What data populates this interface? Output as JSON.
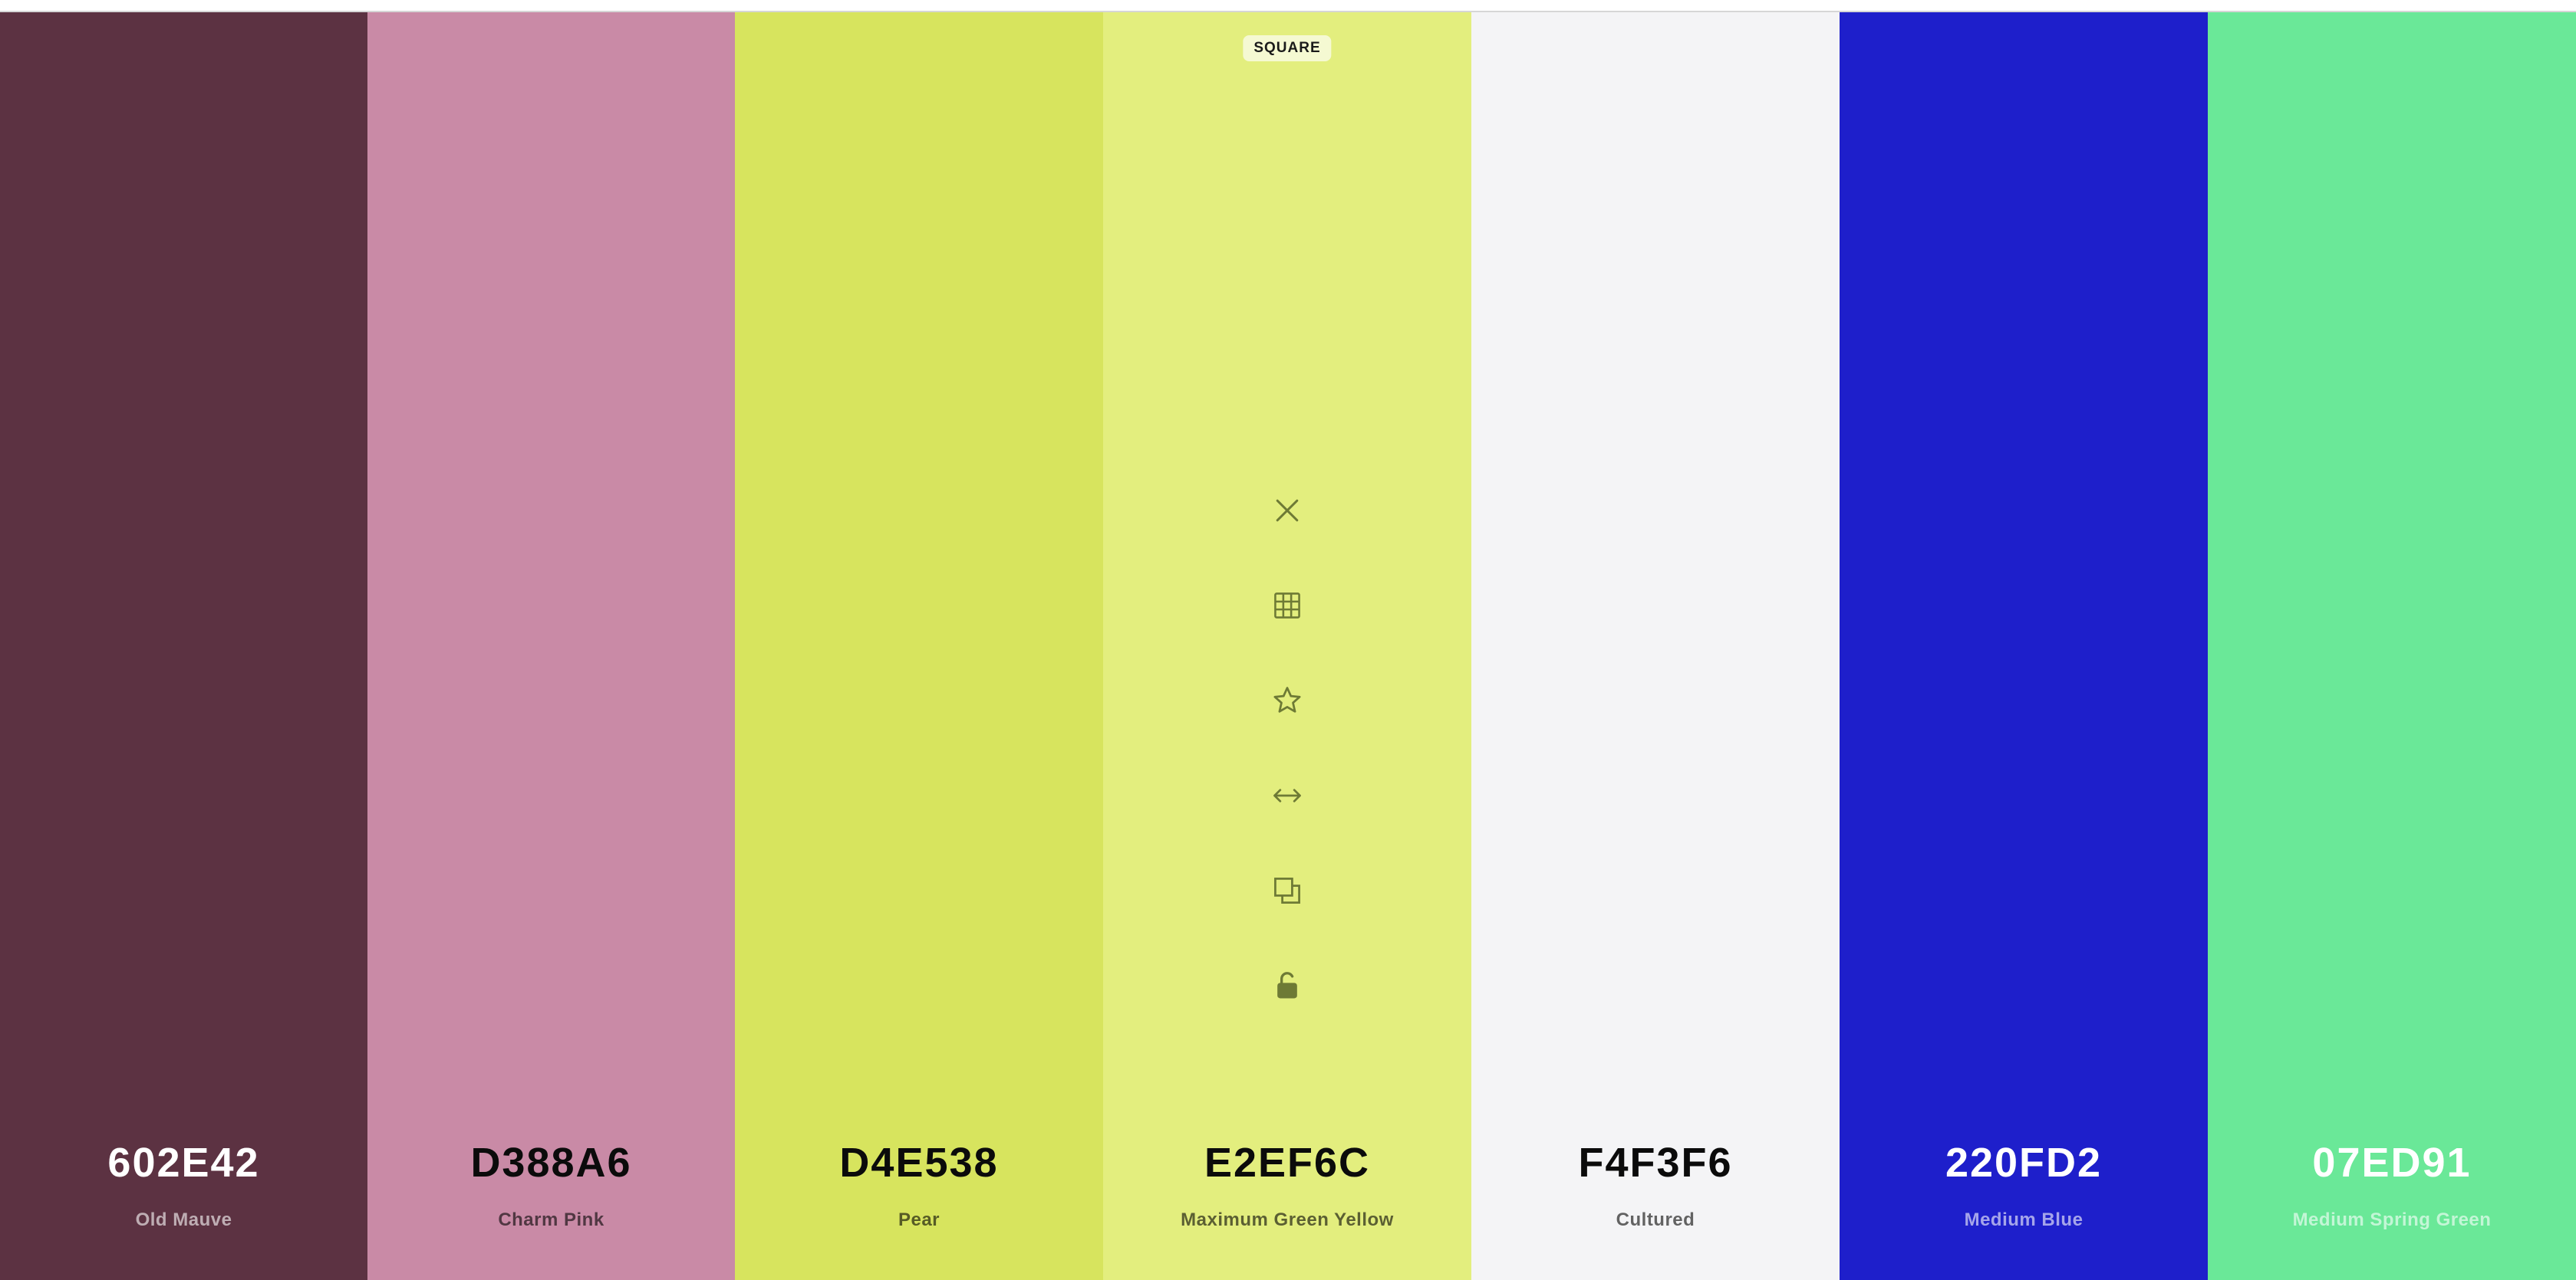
{
  "palette": {
    "swatches": [
      {
        "hex": "602E42",
        "name": "Old Mauve",
        "color": "#5C3242",
        "text_tone": "light"
      },
      {
        "hex": "D388A6",
        "name": "Charm Pink",
        "color": "#C98AA6",
        "text_tone": "dark"
      },
      {
        "hex": "D4E538",
        "name": "Pear",
        "color": "#D7E45E",
        "text_tone": "dark"
      },
      {
        "hex": "E2EF6C",
        "name": "Maximum Green Yellow",
        "color": "#E3EE7E",
        "text_tone": "dark"
      },
      {
        "hex": "F4F3F6",
        "name": "Cultured",
        "color": "#F4F4F6",
        "text_tone": "dark"
      },
      {
        "hex": "220FD2",
        "name": "Medium Blue",
        "color": "#1E1FCB",
        "text_tone": "light"
      },
      {
        "hex": "07ED91",
        "name": "Medium Spring Green",
        "color": "#6AE898",
        "text_tone": "light"
      }
    ],
    "active_swatch_badge": "SQUARE",
    "toolbar": {
      "icon_color": "#6E7A35",
      "items": [
        {
          "icon": "close-icon",
          "action": "remove"
        },
        {
          "icon": "grid-icon",
          "action": "shades"
        },
        {
          "icon": "star-icon",
          "action": "favorite"
        },
        {
          "icon": "drag-arrows-icon",
          "action": "drag"
        },
        {
          "icon": "copy-icon",
          "action": "copy"
        },
        {
          "icon": "unlock-icon",
          "action": "lock"
        }
      ]
    }
  }
}
